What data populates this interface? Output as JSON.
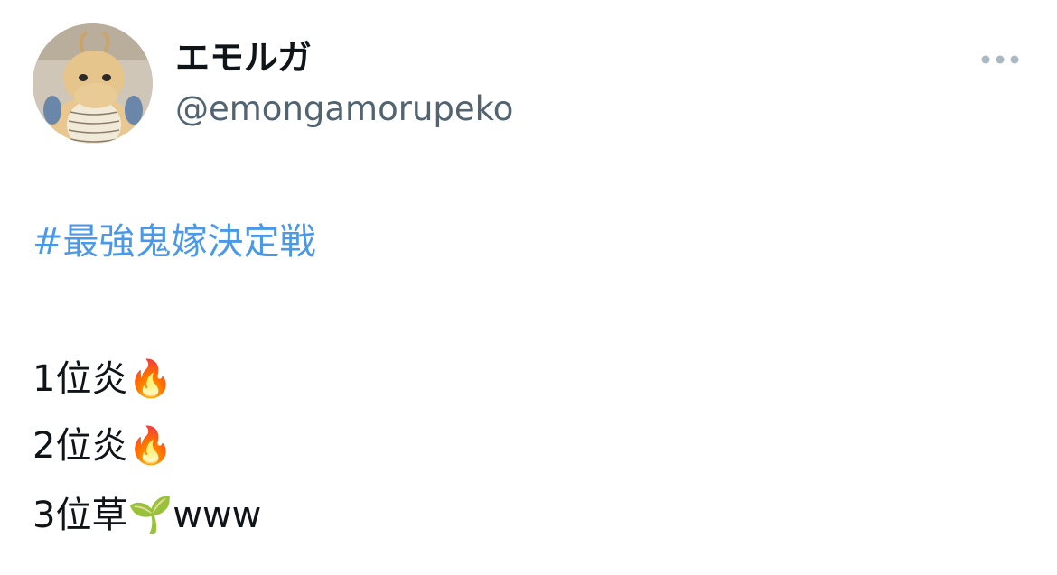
{
  "tweet": {
    "author": {
      "display_name": "エモルガ",
      "handle": "@emongamorupeko",
      "avatar_icon": "plush-dragon-avatar"
    },
    "more_icon": "more-horizontal-icon",
    "hashtag": "#最強鬼嫁決定戦",
    "lines": [
      "1位炎🔥",
      "2位炎🔥",
      "3位草🌱www"
    ]
  },
  "colors": {
    "hashtag": "#4a99e9",
    "handle": "#536471",
    "text": "#0f1419",
    "more_icon": "#aab8c2"
  }
}
